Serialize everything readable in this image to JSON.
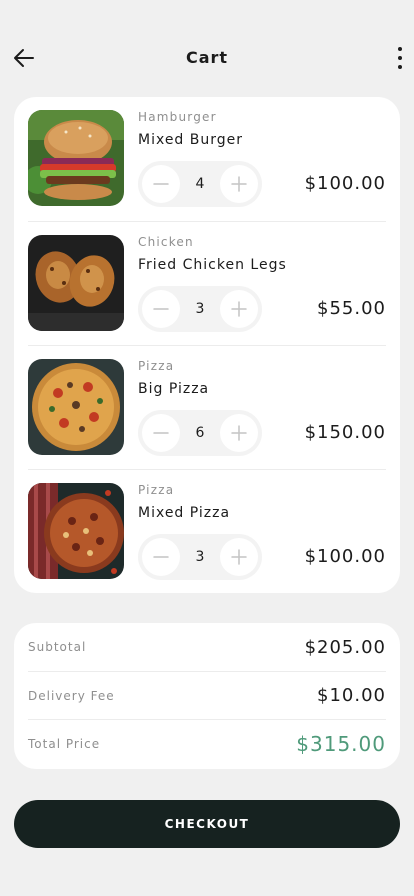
{
  "header": {
    "title": "Cart",
    "back_icon": "arrow-left-icon",
    "menu_icon": "more-vertical-icon"
  },
  "items": [
    {
      "category": "Hamburger",
      "name": "Mixed Burger",
      "quantity": "4",
      "price": "$100.00",
      "image": "burger"
    },
    {
      "category": "Chicken",
      "name": "Fried Chicken Legs",
      "quantity": "3",
      "price": "$55.00",
      "image": "chicken"
    },
    {
      "category": "Pizza",
      "name": "Big Pizza",
      "quantity": "6",
      "price": "$150.00",
      "image": "pizza"
    },
    {
      "category": "Pizza",
      "name": "Mixed Pizza",
      "quantity": "3",
      "price": "$100.00",
      "image": "pizza-mixed"
    }
  ],
  "summary": {
    "subtotal_label": "Subtotal",
    "subtotal_value": "$205.00",
    "delivery_label": "Delivery Fee",
    "delivery_value": "$10.00",
    "total_label": "Total Price",
    "total_value": "$315.00"
  },
  "checkout": {
    "label": "CHECKOUT"
  },
  "colors": {
    "background": "#f0f0f0",
    "card": "#ffffff",
    "stepper_bg": "#f3f3f3",
    "total_accent": "#4f9a7a",
    "checkout_bg": "#162220",
    "muted_text": "#8f8f8f"
  }
}
